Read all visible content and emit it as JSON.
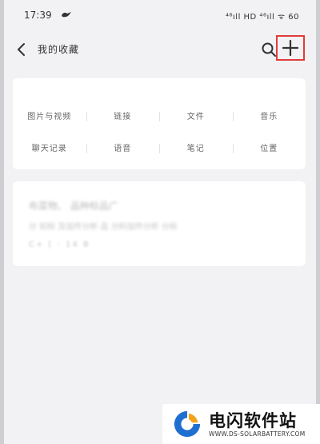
{
  "status_bar": {
    "time": "17:39",
    "app_icon": "bird-icon",
    "signal_text": "⁴⁶ıll HD ⁴⁶ıll ᯤ 60"
  },
  "header": {
    "title": "我的收藏",
    "back_icon": "chevron-left-icon",
    "search_icon": "search-icon",
    "add_icon": "plus-icon",
    "highlight_color": "#e23b3b"
  },
  "categories": [
    [
      "图片与视频",
      "链接",
      "文件",
      "音乐"
    ],
    [
      "聊天记录",
      "语音",
      "笔记",
      "位置"
    ]
  ],
  "favorite_item": {
    "title": "布菜物、 品种标品广",
    "summary": "分 如标 及加件分析 品 分料加件分析 分标",
    "meta": "C+ [ · 14 B"
  },
  "watermark": {
    "name": "电闪软件站",
    "url": "WWW.DS-SOLARBATTERY.COM",
    "colors": {
      "blue": "#1f6fd1",
      "orange": "#f2a31b"
    }
  }
}
